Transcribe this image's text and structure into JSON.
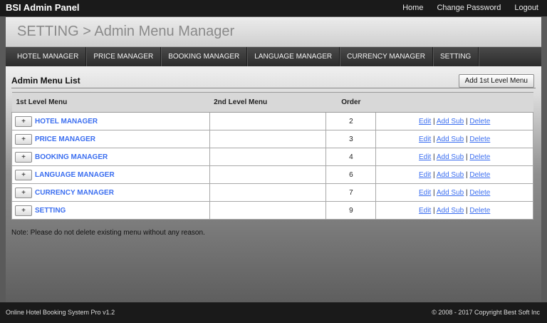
{
  "header": {
    "brand": "BSI Admin Panel",
    "links": [
      "Home",
      "Change Password",
      "Logout"
    ]
  },
  "page": {
    "title": "SETTING > Admin Menu Manager"
  },
  "nav": {
    "tabs": [
      "HOTEL MANAGER",
      "PRICE MANAGER",
      "BOOKING MANAGER",
      "LANGUAGE MANAGER",
      "CURRENCY MANAGER",
      "SETTING"
    ]
  },
  "section": {
    "title": "Admin Menu List",
    "add_button": "Add 1st Level Menu"
  },
  "table": {
    "columns": [
      "1st Level Menu",
      "2nd Level Menu",
      "Order",
      ""
    ],
    "expand_label": "+",
    "action_labels": {
      "edit": "Edit",
      "add_sub": "Add Sub",
      "delete": "Delete",
      "sep": " | "
    },
    "rows": [
      {
        "name": "HOTEL MANAGER",
        "sub": "",
        "order": "2"
      },
      {
        "name": "PRICE MANAGER",
        "sub": "",
        "order": "3"
      },
      {
        "name": "BOOKING MANAGER",
        "sub": "",
        "order": "4"
      },
      {
        "name": "LANGUAGE MANAGER",
        "sub": "",
        "order": "6"
      },
      {
        "name": "CURRENCY MANAGER",
        "sub": "",
        "order": "7"
      },
      {
        "name": "SETTING",
        "sub": "",
        "order": "9"
      }
    ]
  },
  "note": "Note: Please do not delete existing menu without any reason.",
  "footer": {
    "left": "Online Hotel Booking System Pro v1.2",
    "right": "© 2008 - 2017 Copyright Best Soft Inc"
  },
  "colors": {
    "link": "#3b6ef0",
    "topbar": "#1a1a1a",
    "nav": "#2c2c2c"
  }
}
